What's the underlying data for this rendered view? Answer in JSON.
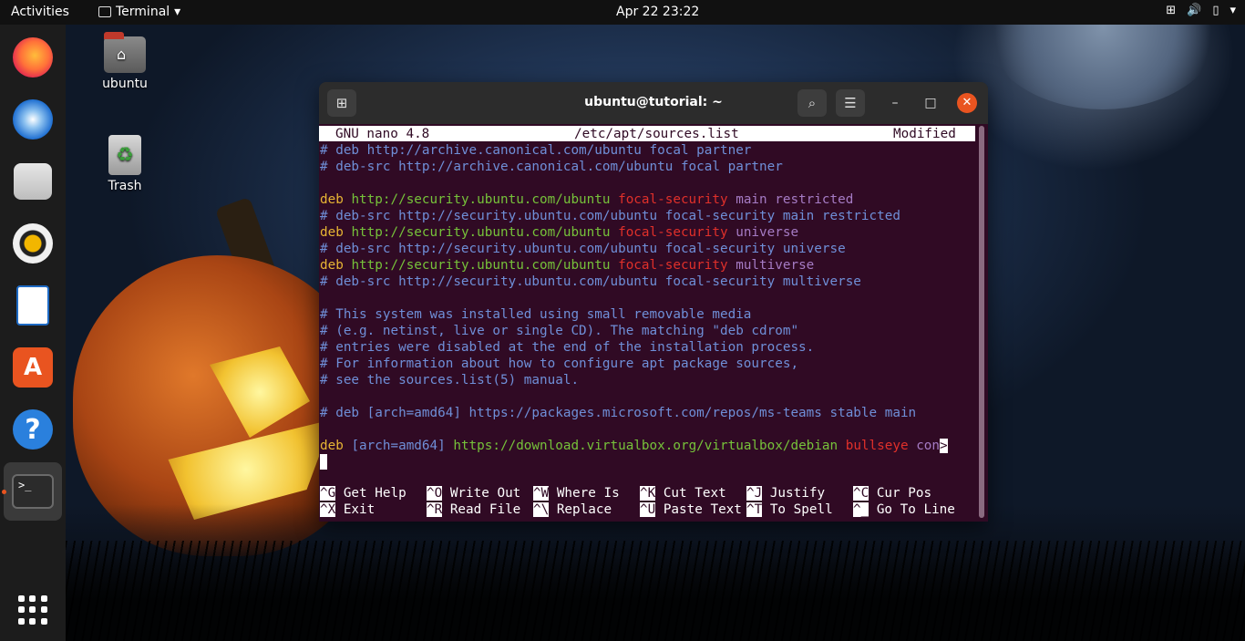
{
  "topbar": {
    "activities": "Activities",
    "app_name": "Terminal",
    "app_caret": "▾",
    "clock": "Apr 22  23:22",
    "network_icon": "⊞",
    "volume_icon": "🔊",
    "battery_icon": "▯",
    "menu_caret": "▾"
  },
  "dock": {
    "items": [
      "firefox",
      "thunderbird",
      "files",
      "rhythmbox",
      "libreoffice-writer",
      "ubuntu-software",
      "help",
      "terminal"
    ],
    "store_glyph": "A",
    "help_glyph": "?",
    "terminal_glyph": ">_"
  },
  "desktop": {
    "home_label": "ubuntu",
    "home_glyph": "⌂",
    "trash_label": "Trash",
    "trash_glyph": "♻"
  },
  "window": {
    "title": "ubuntu@tutorial: ~",
    "newtab_glyph": "⊞",
    "search_glyph": "⌕",
    "menu_glyph": "☰",
    "minimize_glyph": "–",
    "maximize_glyph": "□",
    "close_glyph": "✕"
  },
  "nano": {
    "version": "GNU nano 4.8",
    "file": "/etc/apt/sources.list",
    "status": "Modified",
    "overflow_marker": ">"
  },
  "lines": [
    [
      [
        "c-com",
        "# deb http://archive.canonical.com/ubuntu focal partner"
      ]
    ],
    [
      [
        "c-com",
        "# deb-src http://archive.canonical.com/ubuntu focal partner"
      ]
    ],
    [],
    [
      [
        "c-deb",
        "deb "
      ],
      [
        "c-url",
        "http://security.ubuntu.com/ubuntu "
      ],
      [
        "c-suite",
        "focal-security "
      ],
      [
        "c-comp",
        "main restricted"
      ]
    ],
    [
      [
        "c-com",
        "# deb-src http://security.ubuntu.com/ubuntu focal-security main restricted"
      ]
    ],
    [
      [
        "c-deb",
        "deb "
      ],
      [
        "c-url",
        "http://security.ubuntu.com/ubuntu "
      ],
      [
        "c-suite",
        "focal-security "
      ],
      [
        "c-comp",
        "universe"
      ]
    ],
    [
      [
        "c-com",
        "# deb-src http://security.ubuntu.com/ubuntu focal-security universe"
      ]
    ],
    [
      [
        "c-deb",
        "deb "
      ],
      [
        "c-url",
        "http://security.ubuntu.com/ubuntu "
      ],
      [
        "c-suite",
        "focal-security "
      ],
      [
        "c-comp",
        "multiverse"
      ]
    ],
    [
      [
        "c-com",
        "# deb-src http://security.ubuntu.com/ubuntu focal-security multiverse"
      ]
    ],
    [],
    [
      [
        "c-com",
        "# This system was installed using small removable media"
      ]
    ],
    [
      [
        "c-com",
        "# (e.g. netinst, live or single CD). The matching \"deb cdrom\""
      ]
    ],
    [
      [
        "c-com",
        "# entries were disabled at the end of the installation process."
      ]
    ],
    [
      [
        "c-com",
        "# For information about how to configure apt package sources,"
      ]
    ],
    [
      [
        "c-com",
        "# see the sources.list(5) manual."
      ]
    ],
    [],
    [
      [
        "c-com",
        "# deb [arch=amd64] https://packages.microsoft.com/repos/ms-teams stable main"
      ]
    ],
    [],
    [
      [
        "c-deb",
        "deb "
      ],
      [
        "c-arch",
        "[arch=amd64] "
      ],
      [
        "c-url",
        "https://download.virtualbox.org/virtualbox/debian "
      ],
      [
        "c-suite",
        "bullseye "
      ],
      [
        "c-comp",
        "con"
      ]
    ]
  ],
  "shortcuts": {
    "row1": [
      {
        "key": "^G",
        "label": "Get Help"
      },
      {
        "key": "^O",
        "label": "Write Out"
      },
      {
        "key": "^W",
        "label": "Where Is"
      },
      {
        "key": "^K",
        "label": "Cut Text"
      },
      {
        "key": "^J",
        "label": "Justify"
      },
      {
        "key": "^C",
        "label": "Cur Pos"
      }
    ],
    "row2": [
      {
        "key": "^X",
        "label": "Exit"
      },
      {
        "key": "^R",
        "label": "Read File"
      },
      {
        "key": "^\\",
        "label": "Replace"
      },
      {
        "key": "^U",
        "label": "Paste Text"
      },
      {
        "key": "^T",
        "label": "To Spell"
      },
      {
        "key": "^_",
        "label": "Go To Line"
      }
    ]
  },
  "colors": {
    "terminal_bg": "#300a24",
    "accent": "#e95420"
  }
}
